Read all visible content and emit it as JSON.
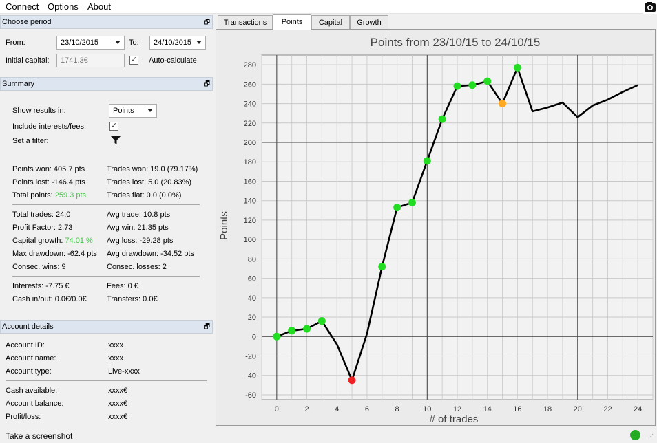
{
  "menu": {
    "connect": "Connect",
    "options": "Options",
    "about": "About"
  },
  "period": {
    "title": "Choose period",
    "from_label": "From:",
    "from_value": "23/10/2015",
    "to_label": "To:",
    "to_value": "24/10/2015",
    "initial_capital_label": "Initial capital:",
    "initial_capital_value": "1741.3€",
    "auto_calc_label": "Auto-calculate",
    "auto_calc_checked": true
  },
  "summary": {
    "title": "Summary",
    "show_results_label": "Show results in:",
    "show_results_value": "Points",
    "include_interests_label": "Include interests/fees:",
    "set_filter_label": "Set a filter:",
    "points_won": "Points won: 405.7 pts",
    "points_lost": "Points lost: -146.4 pts",
    "total_points_label": "Total points: ",
    "total_points_value": "259.3 pts",
    "trades_won": "Trades won: 19.0 (79.17%)",
    "trades_lost": "Trades lost: 5.0 (20.83%)",
    "trades_flat": "Trades flat: 0.0 (0.0%)",
    "total_trades": "Total trades: 24.0",
    "profit_factor": "Profit Factor: 2.73",
    "capital_growth_label": "Capital growth: ",
    "capital_growth_value": "74.01 %",
    "max_drawdown": "Max drawdown: -62.4 pts",
    "consec_wins": "Consec. wins: 9",
    "avg_trade": "Avg trade: 10.8 pts",
    "avg_win": "Avg win: 21.35 pts",
    "avg_loss": "Avg loss: -29.28 pts",
    "avg_drawdown": "Avg drawdown: -34.52 pts",
    "consec_losses": "Consec. losses: 2",
    "interests": "Interests: -7.75 €",
    "cash_in_out": "Cash in/out: 0.0€/0.0€",
    "fees": "Fees: 0 €",
    "transfers": "Transfers: 0.0€"
  },
  "account": {
    "title": "Account details",
    "id_label": "Account ID:",
    "id_value": "xxxx",
    "name_label": "Account name:",
    "name_value": "xxxx",
    "type_label": "Account type:",
    "type_value": "Live-xxxx",
    "cash_label": "Cash available:",
    "cash_value": "xxxx€",
    "balance_label": "Account balance:",
    "balance_value": "xxxx€",
    "pl_label": "Profit/loss:",
    "pl_value": "xxxx€"
  },
  "tabs": {
    "transactions": "Transactions",
    "points": "Points",
    "capital": "Capital",
    "growth": "Growth"
  },
  "status": {
    "screenshot": "Take a screenshot",
    "connection_color": "#22aa22"
  },
  "chart_data": {
    "type": "line",
    "title": "Points from 23/10/15 to 24/10/15",
    "xlabel": "# of trades",
    "ylabel": "Points",
    "xlim": [
      -1,
      25
    ],
    "ylim": [
      -65,
      290
    ],
    "x_ticks": [
      0,
      2,
      4,
      6,
      8,
      10,
      12,
      14,
      16,
      18,
      20,
      22,
      24
    ],
    "y_ticks": [
      -60,
      -40,
      -20,
      0,
      20,
      40,
      60,
      80,
      100,
      120,
      140,
      160,
      180,
      200,
      220,
      240,
      260,
      280
    ],
    "x": [
      0,
      1,
      2,
      3,
      4,
      5,
      6,
      7,
      8,
      9,
      10,
      11,
      12,
      13,
      14,
      15,
      16,
      17,
      18,
      19,
      20,
      21,
      22,
      23,
      24
    ],
    "y": [
      0,
      6,
      8,
      16,
      -8,
      -45,
      3,
      72,
      133,
      138,
      181,
      224,
      258,
      259,
      263,
      240,
      277,
      232,
      236,
      241,
      226,
      238,
      244,
      252,
      259
    ],
    "markers": [
      {
        "x": 0,
        "y": 0,
        "color": "#22dd22"
      },
      {
        "x": 1,
        "y": 6,
        "color": "#22dd22"
      },
      {
        "x": 2,
        "y": 8,
        "color": "#22dd22"
      },
      {
        "x": 3,
        "y": 16,
        "color": "#22dd22"
      },
      {
        "x": 5,
        "y": -45,
        "color": "#ee2222"
      },
      {
        "x": 7,
        "y": 72,
        "color": "#22dd22"
      },
      {
        "x": 8,
        "y": 133,
        "color": "#22dd22"
      },
      {
        "x": 9,
        "y": 138,
        "color": "#22dd22"
      },
      {
        "x": 10,
        "y": 181,
        "color": "#22dd22"
      },
      {
        "x": 11,
        "y": 224,
        "color": "#22dd22"
      },
      {
        "x": 12,
        "y": 258,
        "color": "#22dd22"
      },
      {
        "x": 13,
        "y": 259,
        "color": "#22dd22"
      },
      {
        "x": 14,
        "y": 263,
        "color": "#22dd22"
      },
      {
        "x": 15,
        "y": 240,
        "color": "#ffaa22"
      },
      {
        "x": 16,
        "y": 277,
        "color": "#22dd22"
      }
    ],
    "reference_lines": {
      "x": [
        0,
        10,
        20
      ],
      "y": [
        0,
        200
      ]
    },
    "grid": true
  }
}
